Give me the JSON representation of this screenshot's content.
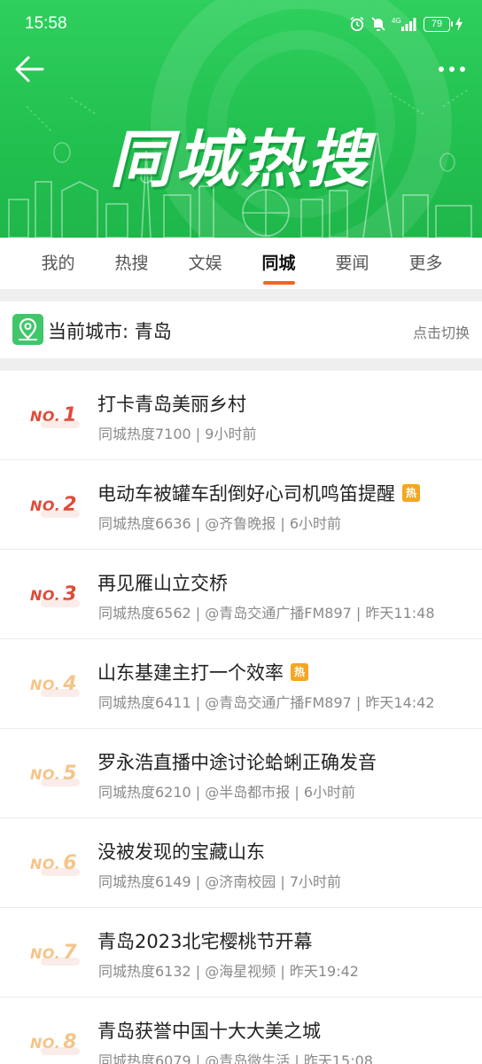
{
  "status_bar": {
    "time": "15:58",
    "network": "4G",
    "battery": "79"
  },
  "header": {
    "title": "同城热搜",
    "back_icon": "arrow-left-icon",
    "more_icon": "more-dots-icon"
  },
  "tabs": [
    {
      "label": "我的",
      "active": false
    },
    {
      "label": "热搜",
      "active": false
    },
    {
      "label": "文娱",
      "active": false
    },
    {
      "label": "同城",
      "active": true
    },
    {
      "label": "要闻",
      "active": false
    },
    {
      "label": "更多",
      "active": false
    }
  ],
  "city": {
    "label": "当前城市: 青岛",
    "switch_label": "点击切换",
    "icon": "map-pin-icon"
  },
  "hot_tag_label": "热",
  "colors": {
    "header_green": "#22c150",
    "tab_indicator": "#f26522",
    "rank_top": "#e04a3a",
    "rank_mid": "#f5c488",
    "hot_tag": "#f5a623"
  },
  "items": [
    {
      "rank_prefix": "NO.",
      "rank": "1",
      "title": "打卡青岛美丽乡村",
      "meta": "同城热度7100 | 9小时前",
      "hot": false
    },
    {
      "rank_prefix": "NO.",
      "rank": "2",
      "title": "电动车被罐车刮倒好心司机鸣笛提醒",
      "meta": "同城热度6636 | @齐鲁晚报 | 6小时前",
      "hot": true
    },
    {
      "rank_prefix": "NO.",
      "rank": "3",
      "title": "再见雁山立交桥",
      "meta": "同城热度6562 | @青岛交通广播FM897 | 昨天11:48",
      "hot": false
    },
    {
      "rank_prefix": "NO.",
      "rank": "4",
      "title": "山东基建主打一个效率",
      "meta": "同城热度6411 | @青岛交通广播FM897 | 昨天14:42",
      "hot": true
    },
    {
      "rank_prefix": "NO.",
      "rank": "5",
      "title": "罗永浩直播中途讨论蛤蜊正确发音",
      "meta": "同城热度6210 | @半岛都市报 | 6小时前",
      "hot": false
    },
    {
      "rank_prefix": "NO.",
      "rank": "6",
      "title": "没被发现的宝藏山东",
      "meta": "同城热度6149 | @济南校园 | 7小时前",
      "hot": false
    },
    {
      "rank_prefix": "NO.",
      "rank": "7",
      "title": "青岛2023北宅樱桃节开幕",
      "meta": "同城热度6132 | @海星视频 | 昨天19:42",
      "hot": false
    },
    {
      "rank_prefix": "NO.",
      "rank": "8",
      "title": "青岛获誉中国十大大美之城",
      "meta": "同城热度6079 | @青岛微生活 | 昨天15:08",
      "hot": false
    }
  ]
}
